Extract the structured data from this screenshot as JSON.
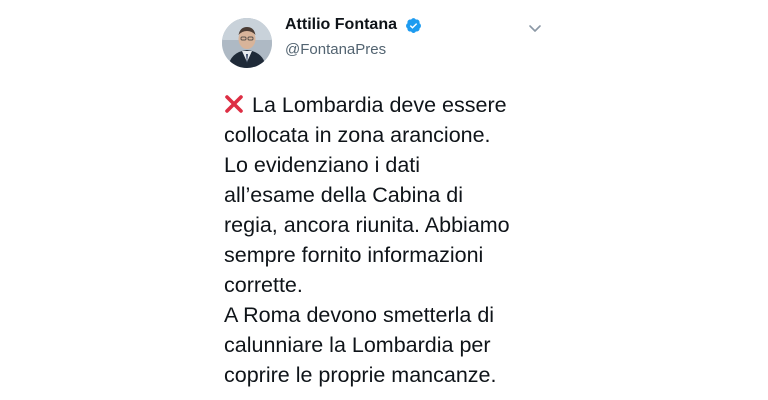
{
  "tweet": {
    "author": {
      "display_name": "Attilio Fontana",
      "handle": "@FontanaPres",
      "verified_icon": "verified-badge-icon",
      "avatar_icon": "avatar"
    },
    "menu_icon": "chevron-down-icon",
    "lead_icon": "cross-mark-icon",
    "text": "La Lombardia deve essere\ncollocata in zona arancione.\nLo evidenziano i dati\nall’esame della Cabina di\nregia, ancora riunita. Abbiamo\nsempre fornito informazioni\ncorrette.\nA Roma devono smetterla di\ncalunniare la Lombardia per\ncoprire le proprie mancanze."
  },
  "colors": {
    "text": "#0f1419",
    "secondary_text": "#536471",
    "verified_blue": "#1d9bf0",
    "cross_red": "#dd2e44"
  }
}
